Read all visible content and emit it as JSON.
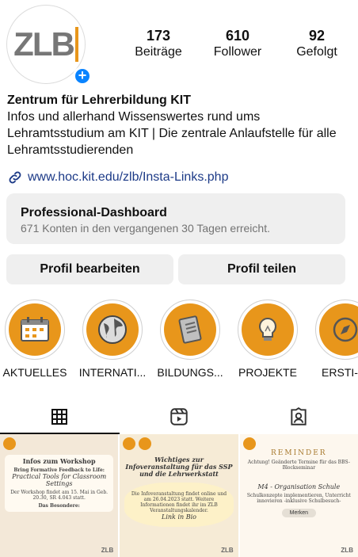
{
  "profile": {
    "avatar_text": "ZLB",
    "stats": [
      {
        "count": "173",
        "label": "Beiträge"
      },
      {
        "count": "610",
        "label": "Follower"
      },
      {
        "count": "92",
        "label": "Gefolgt"
      }
    ],
    "name": "Zentrum für Lehrerbildung KIT",
    "bio": "Infos und allerhand Wissenswertes rund ums Lehramtsstudium am KIT | Die zentrale Anlaufstelle für alle Lehramtsstudierenden",
    "link": "www.hoc.kit.edu/zlb/Insta-Links.php"
  },
  "dashboard": {
    "title": "Professional-Dashboard",
    "subtitle": "671 Konten in den vergangenen 30 Tagen erreicht."
  },
  "buttons": {
    "edit": "Profil bearbeiten",
    "share": "Profil teilen"
  },
  "highlights": [
    {
      "label": "AKTUELLES",
      "icon": "calendar-icon"
    },
    {
      "label": "INTERNATI...",
      "icon": "globe-icon"
    },
    {
      "label": "BILDUNGS...",
      "icon": "document-icon"
    },
    {
      "label": "PROJEKTE",
      "icon": "lightbulb-icon"
    },
    {
      "label": "ERSTI-HI",
      "icon": "compass-icon"
    }
  ],
  "posts": [
    {
      "title": "Infos zum Workshop",
      "subtitle": "Bring Formative Feedback to Life:",
      "script": "Practical Tools for Classroom Settings",
      "line1": "Der Workshop findet am 15. Mai in Geb. 20.30, SR 4.043 statt.",
      "line2": "Das Besondere:",
      "footer": "ZLB"
    },
    {
      "title": "Wichtiges zur Infoveranstaltung für das SSP und die Lehrwerkstatt",
      "body": "Die Infoveranstaltung findet online und am 26.04.2023 statt. Weitere Informationen findet ihr im ZLB Veranstaltungskalender.",
      "script": "Link in Bio",
      "footer": "ZLB"
    },
    {
      "title": "REMINDER",
      "body": "Achtung! Geänderte Termine für das BBS-Blockseminar",
      "script": "M4 - Organisation Schule",
      "small": "Schulkonzepte implementieren, Unterricht innovieren -inklusive Schulbesuch-",
      "button": "Merken",
      "footer": "ZLB"
    }
  ],
  "colors": {
    "accent": "#e8961b",
    "link": "#1c3a87",
    "badge_blue": "#0a84ff",
    "button_bg": "#efefef"
  }
}
